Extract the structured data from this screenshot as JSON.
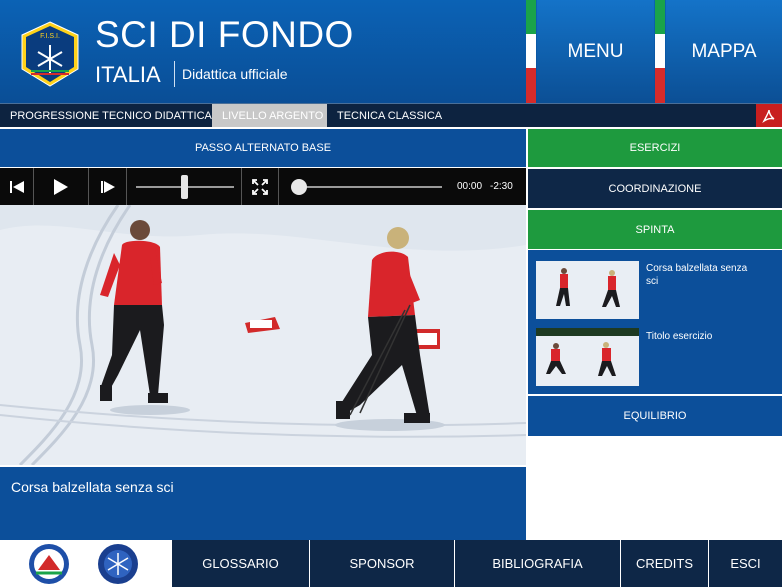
{
  "header": {
    "title": "SCI DI FONDO",
    "subtitle": "ITALIA",
    "tagline": "Didattica ufficiale",
    "menu_label": "MENU",
    "map_label": "MAPPA",
    "logo_text": "F.I.S.I."
  },
  "tabs": [
    {
      "label": "PROGRESSIONE TECNICO DIDATTICA"
    },
    {
      "label": "LIVELLO ARGENTO"
    },
    {
      "label": "TECNICA CLASSICA"
    }
  ],
  "pdf_icon": "pdf-icon",
  "video": {
    "section_title": "PASSO ALTERNATO BASE",
    "time_elapsed": "00:00",
    "time_remaining": "-2:30",
    "volume_level": 0.49,
    "progress": 0.0,
    "caption": "Corsa balzellata senza sci"
  },
  "sidebar": {
    "esercizi": "ESERCIZI",
    "coordinazione": "COORDINAZIONE",
    "spinta": "SPINTA",
    "exercises": [
      {
        "label": "Corsa balzellata senza sci"
      },
      {
        "label": "Titolo esercizio"
      }
    ],
    "equilibrio": "EQUILIBRIO"
  },
  "bottom_nav": [
    {
      "label": "GLOSSARIO"
    },
    {
      "label": "SPONSOR"
    },
    {
      "label": "BIBLIOGRAFIA"
    },
    {
      "label": "CREDITS"
    },
    {
      "label": "ESCI"
    }
  ],
  "colors": {
    "header_blue": "#0b62b5",
    "navy": "#0e2747",
    "panel_blue": "#0c4f9a",
    "green": "#1e9a3e",
    "pdf_red": "#c81f1f"
  }
}
